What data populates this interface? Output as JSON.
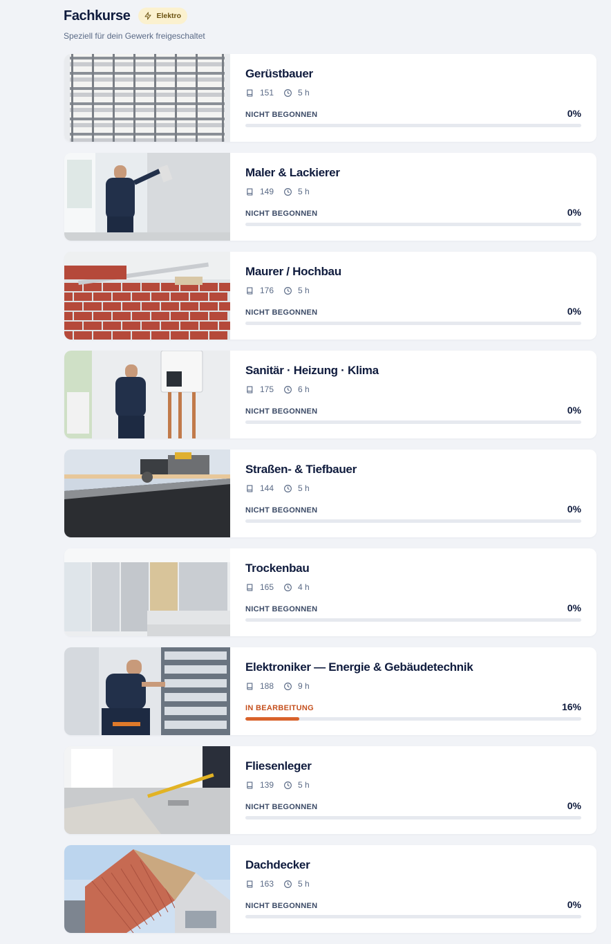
{
  "header": {
    "title": "Fachkurse",
    "badge": "Elektro",
    "badge_icon": "lightning-icon",
    "subtitle": "Speziell für dein Gewerk freigeschaltet"
  },
  "colors": {
    "accent": "#d9622b",
    "badge_bg": "#fbf1cf",
    "title": "#0f1b3d"
  },
  "courses": [
    {
      "title": "Gerüstbauer",
      "lessons": "151",
      "duration": "5 h",
      "status": "NICHT BEGONNEN",
      "percent": "0%",
      "progress": 0,
      "image": "scaffolding"
    },
    {
      "title": "Maler & Lackierer",
      "lessons": "149",
      "duration": "5 h",
      "status": "NICHT BEGONNEN",
      "percent": "0%",
      "progress": 0,
      "image": "painter"
    },
    {
      "title": "Maurer / Hochbau",
      "lessons": "176",
      "duration": "5 h",
      "status": "NICHT BEGONNEN",
      "percent": "0%",
      "progress": 0,
      "image": "bricks"
    },
    {
      "title": "Sanitär · Heizung · Klima",
      "lessons": "175",
      "duration": "6 h",
      "status": "NICHT BEGONNEN",
      "percent": "0%",
      "progress": 0,
      "image": "plumber"
    },
    {
      "title": "Straßen- & Tiefbauer",
      "lessons": "144",
      "duration": "5 h",
      "status": "NICHT BEGONNEN",
      "percent": "0%",
      "progress": 0,
      "image": "road"
    },
    {
      "title": "Trockenbau",
      "lessons": "165",
      "duration": "4 h",
      "status": "NICHT BEGONNEN",
      "percent": "0%",
      "progress": 0,
      "image": "drywall"
    },
    {
      "title": "Elektroniker — Energie & Gebäudetechnik",
      "lessons": "188",
      "duration": "9 h",
      "status": "IN BEARBEITUNG",
      "percent": "16%",
      "progress": 0.16,
      "image": "electrician"
    },
    {
      "title": "Fliesenleger",
      "lessons": "139",
      "duration": "5 h",
      "status": "NICHT BEGONNEN",
      "percent": "0%",
      "progress": 0,
      "image": "tiles"
    },
    {
      "title": "Dachdecker",
      "lessons": "163",
      "duration": "5 h",
      "status": "NICHT BEGONNEN",
      "percent": "0%",
      "progress": 0,
      "image": "roof"
    }
  ]
}
